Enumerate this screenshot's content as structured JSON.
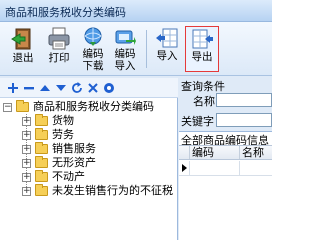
{
  "window": {
    "title": "商品和服务税收分类编码"
  },
  "toolbar": {
    "buttons": [
      {
        "label": "退出",
        "icon": "exit-icon"
      },
      {
        "label": "打印",
        "icon": "printer-icon"
      },
      {
        "label": "编码",
        "label2": "下载",
        "icon": "download-icon"
      },
      {
        "label": "编码",
        "label2": "导入",
        "icon": "import-code-icon"
      },
      {
        "label": "导入",
        "icon": "import-icon"
      },
      {
        "label": "导出",
        "icon": "export-icon"
      }
    ]
  },
  "tree": {
    "root": "商品和服务税收分类编码",
    "items": [
      "货物",
      "劳务",
      "销售服务",
      "无形资产",
      "不动产",
      "未发生销售行为的不征税"
    ]
  },
  "conditions": {
    "title": "查询条件",
    "name_label": "名称",
    "keyword_label": "关键字"
  },
  "grid": {
    "caption": "全部商品编码信息",
    "columns": [
      "编码",
      "名称"
    ]
  },
  "colors": {
    "highlight_border": "#e53a3a",
    "accent": "#2a67c8"
  }
}
